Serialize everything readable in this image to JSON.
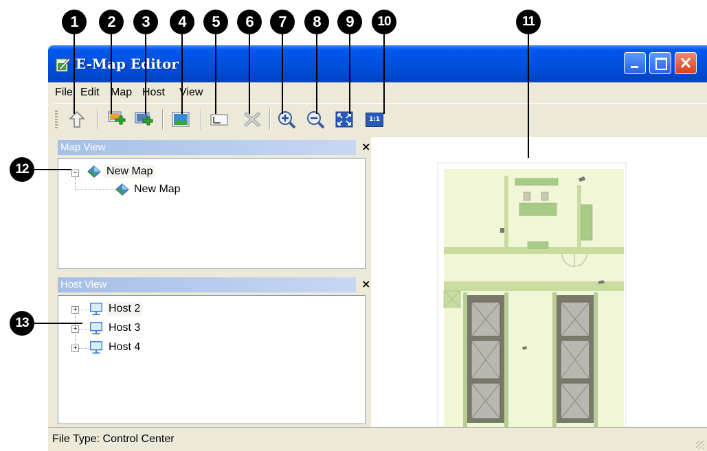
{
  "callouts": [
    "1",
    "2",
    "3",
    "4",
    "5",
    "6",
    "7",
    "8",
    "9",
    "10",
    "11",
    "12",
    "13"
  ],
  "window": {
    "title": "E-Map Editor",
    "title_icon": "emap-editor-icon"
  },
  "menu": {
    "items": [
      "File",
      "Edit",
      "Map",
      "Host",
      "View"
    ]
  },
  "toolbar": {
    "tools": [
      {
        "icon": "up-level-icon"
      },
      {
        "icon": "add-map-icon"
      },
      {
        "icon": "add-submap-icon"
      },
      {
        "icon": "map-image-icon"
      },
      {
        "icon": "rename-icon"
      },
      {
        "icon": "delete-icon"
      },
      {
        "icon": "zoom-in-icon"
      },
      {
        "icon": "zoom-out-icon"
      },
      {
        "icon": "fit-to-window-icon"
      },
      {
        "icon": "actual-size-icon",
        "label": "1:1"
      }
    ]
  },
  "map_view": {
    "header": "Map View",
    "close": "×",
    "tree": [
      {
        "label": "New Map",
        "expander": "−"
      },
      {
        "label": "New Map"
      }
    ]
  },
  "host_view": {
    "header": "Host View",
    "close": "×",
    "tree": [
      {
        "label": "Host 2",
        "expander": "+"
      },
      {
        "label": "Host 3",
        "expander": "+"
      },
      {
        "label": "Host 4",
        "expander": "+"
      }
    ]
  },
  "status": {
    "text": "File Type: Control Center"
  },
  "colors": {
    "titlebar": "#0052e0",
    "pane_header": "#a6bfe8",
    "map_background": "#f1f6d6",
    "map_wall": "#c8dca0"
  }
}
